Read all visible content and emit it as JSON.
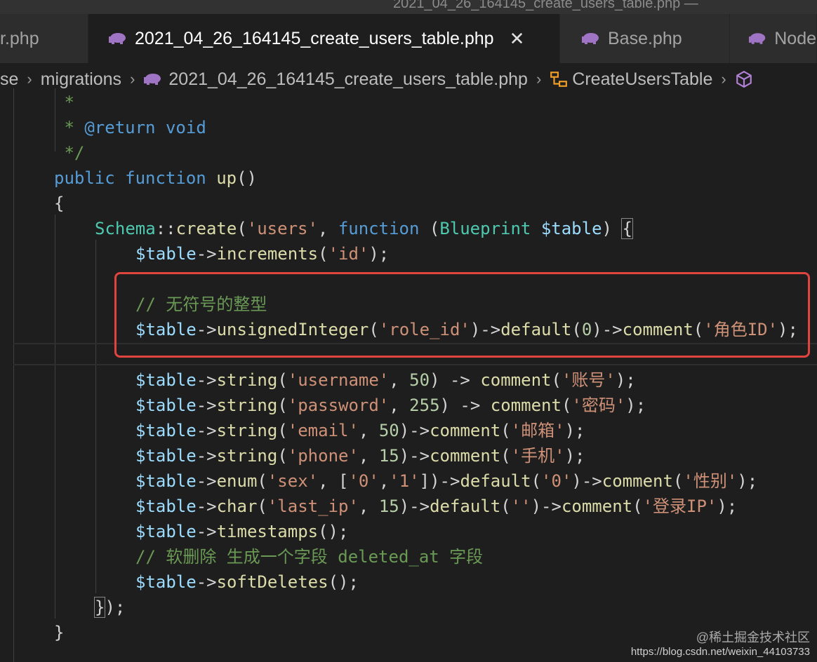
{
  "titlebar": {
    "text": "2021_04_26_164145_create_users_table.php — "
  },
  "tabs": [
    {
      "label": "r.php",
      "active": false
    },
    {
      "label": "2021_04_26_164145_create_users_table.php",
      "active": true,
      "close": "✕"
    },
    {
      "label": "Base.php",
      "active": false
    },
    {
      "label": "Node",
      "active": false
    }
  ],
  "breadcrumb": {
    "parts": [
      "se",
      "migrations",
      "2021_04_26_164145_create_users_table.php",
      "CreateUsersTable"
    ],
    "separator": "›"
  },
  "code": {
    "lines": [
      [
        [
          "cmt",
          " *"
        ]
      ],
      [
        [
          "cmt",
          " * "
        ],
        [
          "kw",
          "@return"
        ],
        [
          "cmt",
          " "
        ],
        [
          "kw",
          "void"
        ]
      ],
      [
        [
          "cmt",
          " */"
        ]
      ],
      [
        [
          "kw",
          "public"
        ],
        [
          "plain",
          " "
        ],
        [
          "kw",
          "function"
        ],
        [
          "plain",
          " "
        ],
        [
          "fn",
          "up"
        ],
        [
          "plain",
          "()"
        ]
      ],
      [
        [
          "plain",
          "{"
        ]
      ],
      [
        [
          "cls",
          "Schema"
        ],
        [
          "plain",
          "::"
        ],
        [
          "fn",
          "create"
        ],
        [
          "plain",
          "("
        ],
        [
          "str",
          "'users'"
        ],
        [
          "plain",
          ", "
        ],
        [
          "kw",
          "function"
        ],
        [
          "plain",
          " ("
        ],
        [
          "cls",
          "Blueprint"
        ],
        [
          "plain",
          " "
        ],
        [
          "var",
          "$table"
        ],
        [
          "plain",
          ") "
        ],
        [
          "bracket",
          "{"
        ]
      ],
      [
        [
          "var",
          "$table"
        ],
        [
          "plain",
          "->"
        ],
        [
          "fn",
          "increments"
        ],
        [
          "plain",
          "("
        ],
        [
          "str",
          "'id'"
        ],
        [
          "plain",
          ");"
        ]
      ],
      [],
      [
        [
          "cmt",
          "// 无符号的整型"
        ]
      ],
      [
        [
          "var",
          "$table"
        ],
        [
          "plain",
          "->"
        ],
        [
          "fn",
          "unsignedInteger"
        ],
        [
          "plain",
          "("
        ],
        [
          "str",
          "'role_id'"
        ],
        [
          "plain",
          ")->"
        ],
        [
          "fn",
          "default"
        ],
        [
          "plain",
          "("
        ],
        [
          "num",
          "0"
        ],
        [
          "plain",
          ")->"
        ],
        [
          "fn",
          "comment"
        ],
        [
          "plain",
          "("
        ],
        [
          "str",
          "'角色ID'"
        ],
        [
          "plain",
          ");"
        ]
      ],
      [],
      [
        [
          "var",
          "$table"
        ],
        [
          "plain",
          "->"
        ],
        [
          "fn",
          "string"
        ],
        [
          "plain",
          "("
        ],
        [
          "str",
          "'username'"
        ],
        [
          "plain",
          ", "
        ],
        [
          "num",
          "50"
        ],
        [
          "plain",
          ") -> "
        ],
        [
          "fn",
          "comment"
        ],
        [
          "plain",
          "("
        ],
        [
          "str",
          "'账号'"
        ],
        [
          "plain",
          ");"
        ]
      ],
      [
        [
          "var",
          "$table"
        ],
        [
          "plain",
          "->"
        ],
        [
          "fn",
          "string"
        ],
        [
          "plain",
          "("
        ],
        [
          "str",
          "'password'"
        ],
        [
          "plain",
          ", "
        ],
        [
          "num",
          "255"
        ],
        [
          "plain",
          ") -> "
        ],
        [
          "fn",
          "comment"
        ],
        [
          "plain",
          "("
        ],
        [
          "str",
          "'密码'"
        ],
        [
          "plain",
          ");"
        ]
      ],
      [
        [
          "var",
          "$table"
        ],
        [
          "plain",
          "->"
        ],
        [
          "fn",
          "string"
        ],
        [
          "plain",
          "("
        ],
        [
          "str",
          "'email'"
        ],
        [
          "plain",
          ", "
        ],
        [
          "num",
          "50"
        ],
        [
          "plain",
          ")->"
        ],
        [
          "fn",
          "comment"
        ],
        [
          "plain",
          "("
        ],
        [
          "str",
          "'邮箱'"
        ],
        [
          "plain",
          ");"
        ]
      ],
      [
        [
          "var",
          "$table"
        ],
        [
          "plain",
          "->"
        ],
        [
          "fn",
          "string"
        ],
        [
          "plain",
          "("
        ],
        [
          "str",
          "'phone'"
        ],
        [
          "plain",
          ", "
        ],
        [
          "num",
          "15"
        ],
        [
          "plain",
          ")->"
        ],
        [
          "fn",
          "comment"
        ],
        [
          "plain",
          "("
        ],
        [
          "str",
          "'手机'"
        ],
        [
          "plain",
          ");"
        ]
      ],
      [
        [
          "var",
          "$table"
        ],
        [
          "plain",
          "->"
        ],
        [
          "fn",
          "enum"
        ],
        [
          "plain",
          "("
        ],
        [
          "str",
          "'sex'"
        ],
        [
          "plain",
          ", ["
        ],
        [
          "str",
          "'0'"
        ],
        [
          "plain",
          ","
        ],
        [
          "str",
          "'1'"
        ],
        [
          "plain",
          "])->"
        ],
        [
          "fn",
          "default"
        ],
        [
          "plain",
          "("
        ],
        [
          "str",
          "'0'"
        ],
        [
          "plain",
          ")->"
        ],
        [
          "fn",
          "comment"
        ],
        [
          "plain",
          "("
        ],
        [
          "str",
          "'性别'"
        ],
        [
          "plain",
          ");"
        ]
      ],
      [
        [
          "var",
          "$table"
        ],
        [
          "plain",
          "->"
        ],
        [
          "fn",
          "char"
        ],
        [
          "plain",
          "("
        ],
        [
          "str",
          "'last_ip'"
        ],
        [
          "plain",
          ", "
        ],
        [
          "num",
          "15"
        ],
        [
          "plain",
          ")->"
        ],
        [
          "fn",
          "default"
        ],
        [
          "plain",
          "("
        ],
        [
          "str",
          "''"
        ],
        [
          "plain",
          ")->"
        ],
        [
          "fn",
          "comment"
        ],
        [
          "plain",
          "("
        ],
        [
          "str",
          "'登录IP'"
        ],
        [
          "plain",
          ");"
        ]
      ],
      [
        [
          "var",
          "$table"
        ],
        [
          "plain",
          "->"
        ],
        [
          "fn",
          "timestamps"
        ],
        [
          "plain",
          "();"
        ]
      ],
      [
        [
          "cmt",
          "// 软删除 生成一个字段 deleted_at 字段"
        ]
      ],
      [
        [
          "var",
          "$table"
        ],
        [
          "plain",
          "->"
        ],
        [
          "fn",
          "softDeletes"
        ],
        [
          "plain",
          "();"
        ]
      ],
      [
        [
          "bracket",
          "}"
        ],
        [
          "plain",
          ");"
        ]
      ],
      [
        [
          "plain",
          "}"
        ]
      ]
    ]
  },
  "watermark": {
    "line1": "@稀土掘金技术社区",
    "line2": "https://blog.csdn.net/weixin_44103733"
  },
  "colors": {
    "background": "#1e1e1e",
    "highlight_border": "#e0443e",
    "php_icon": "#a074c4"
  }
}
